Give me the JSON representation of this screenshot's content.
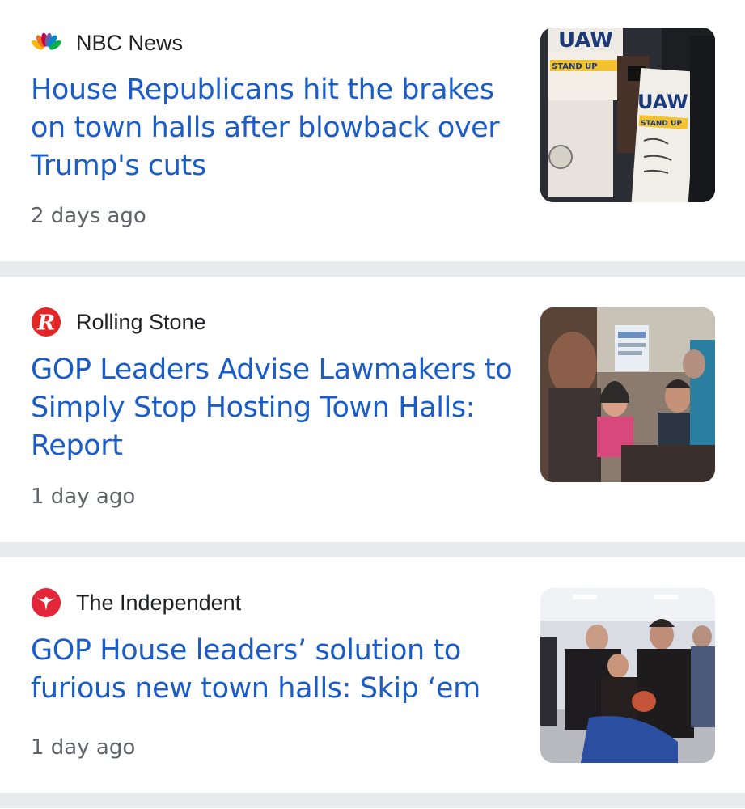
{
  "articles": [
    {
      "source": "NBC News",
      "source_icon": "nbc-peacock-icon",
      "headline": "House Republicans hit the brakes on town halls after blowback over Trump's cuts",
      "time": "2 days ago",
      "thumbnail": {
        "signs": [
          "UAW",
          "STAND UP",
          "UAW",
          "STAND UP"
        ]
      }
    },
    {
      "source": "Rolling Stone",
      "source_icon": "rolling-stone-r-icon",
      "headline": "GOP Leaders Advise Lawmakers to Simply Stop Hosting Town Halls: Report",
      "time": "1 day ago"
    },
    {
      "source": "The Independent",
      "source_icon": "independent-eagle-icon",
      "headline": "GOP House leaders’ solution to furious new town halls: Skip ‘em",
      "time": "1 day ago"
    }
  ],
  "colors": {
    "headline": "#1a5cc8",
    "source": "#202124",
    "time": "#5f6368",
    "separator": "#e8eaed",
    "rolling_stone_red": "#e32726",
    "independent_red": "#e3263a"
  }
}
